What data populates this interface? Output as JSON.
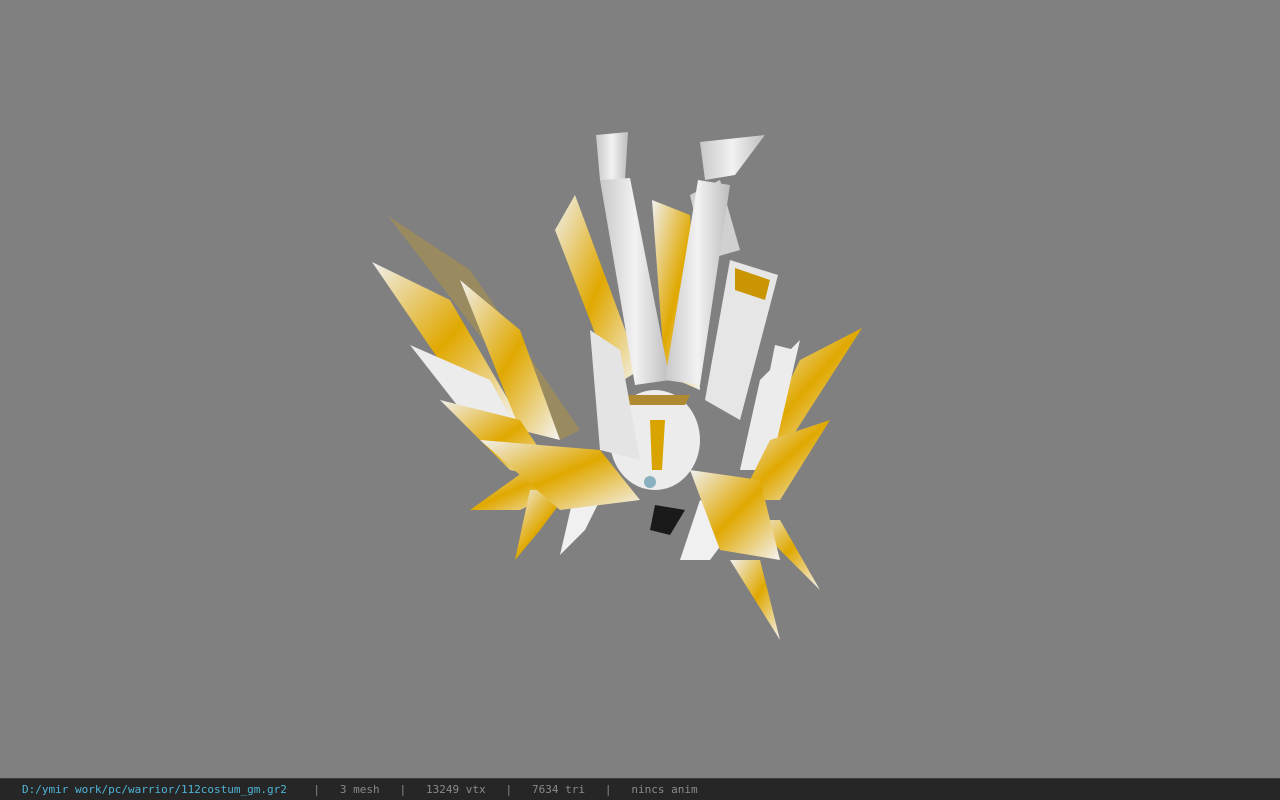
{
  "viewer": {
    "background_color": "#808080",
    "model_colors": {
      "white": "#e8e8e8",
      "shadow": "#b8b8b8",
      "gold": "#e0a800",
      "dark_gold": "#a07000"
    }
  },
  "status_bar": {
    "file_path": "D:/ymir work/pc/warrior/112costum_gm.gr2",
    "separator": "|",
    "mesh_count": "3 mesh",
    "vertex_count": "13249 vtx",
    "triangle_count": "7634 tri",
    "animation": "nincs anim",
    "path_color": "#4fb4d8",
    "text_color": "#8a8a8a"
  }
}
